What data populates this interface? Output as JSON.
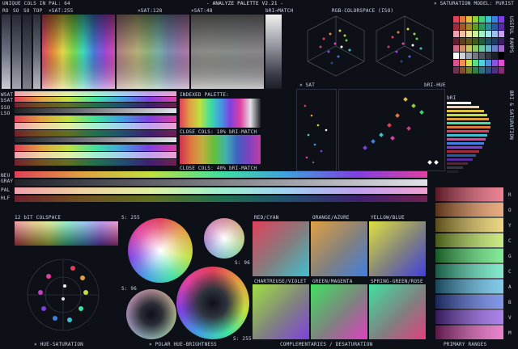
{
  "header": {
    "unique": "UNIQUE COLS IN PAL: 64",
    "sat255": "×SAT:255",
    "sat128": "×SAT:128",
    "sat48": "×SAT:48",
    "brimatch": "bRI→MATCH",
    "title": "- ANALYZE PALETTE V2.21 -",
    "rgb": "RGB-COLORSPACE (ISO)",
    "model": "× SATURATION MODEL: PURIST"
  },
  "left_labels": {
    "ro": "RO",
    "so": "SO",
    "so2": "SO",
    "top": "TOP",
    "wsat": "WSAT",
    "bsat": "bSAT",
    "sso": "SSO",
    "lso": "LSO",
    "neu": "NEU",
    "gray": "GRAY",
    "pal": "PAL",
    "hlf": "HLF"
  },
  "indexed": {
    "label": "INDEXED PALETTE:"
  },
  "close1": "CLOSE COLS: 10% bRI-MATCH",
  "close2": "CLOSE COLS: 40% bRI-MATCH",
  "plot_labels": {
    "xsat": "× SAT",
    "brihue": "bRI-HUE",
    "bri": "bRI"
  },
  "side_vert": {
    "useful": "USEFUL RAMPS",
    "bri_sat": "BRI & SATURATION"
  },
  "bit12": "12 bIT COLSPACE",
  "wheels": {
    "s255": "S: 255",
    "s96": "S: 96",
    "s96b": "S: 96",
    "s255b": "S: 255"
  },
  "hue_pairs": [
    "RED/CYAN",
    "ORANGE/AZURE",
    "YELLOW/BLUE",
    "CHARTREUSE/VIOLET",
    "GREEN/MAGENTA",
    "SPRING-GREEN/ROSE"
  ],
  "ramp_letters": [
    "R",
    "O",
    "Y",
    "C",
    "G",
    "C",
    "A",
    "B",
    "V",
    "M"
  ],
  "footer": {
    "hue_sat": "× HUE-SATURATION",
    "polar": "× POLAR HUE-BRIGHTNESS",
    "comp": "COMPLEMENTARIES / DESATURATION",
    "primary": "PRIMARY RANGES"
  },
  "colors": {
    "bg": "#0d1017",
    "panel": "#161b26",
    "text": "#cfd6e6"
  }
}
